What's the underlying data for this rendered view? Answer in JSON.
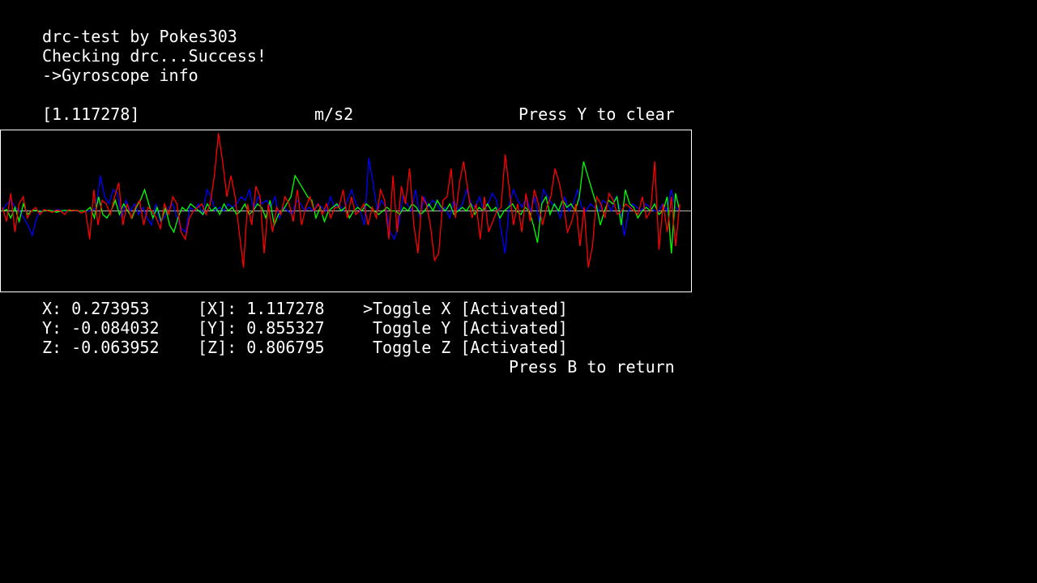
{
  "header": {
    "title": "drc-test by Pokes303",
    "status": "Checking drc...Success!",
    "menu_item": "->Gyroscope info"
  },
  "graph_header": {
    "scale_value": "[1.117278]",
    "unit": "m/s2",
    "clear_hint": "Press Y to clear"
  },
  "readings": {
    "x": "X: 0.273953",
    "y": "Y: -0.084032",
    "z": "Z: -0.063952",
    "max_x": "[X]: 1.117278",
    "max_y": "[Y]: 0.855327",
    "max_z": "[Z]: 0.806795"
  },
  "toggles": {
    "x": ">Toggle X [Activated]",
    "y": "Toggle Y [Activated]",
    "z": "Toggle Z [Activated]"
  },
  "footer": {
    "return_hint": "Press B to return"
  },
  "colors": {
    "background": "#000000",
    "text": "#ffffff",
    "x_series": "#ff0000",
    "y_series": "#00ff00",
    "z_series": "#0000ff",
    "center_line": "#ffffff"
  },
  "chart_data": {
    "type": "line",
    "title": "",
    "ylabel": "m/s2",
    "ylim": [
      -1.117278,
      1.117278
    ],
    "series": [
      {
        "name": "X",
        "color": "#ff0000",
        "values": [
          0.05,
          -0.15,
          0.25,
          -0.3,
          0.1,
          0.2,
          -0.1,
          0.0,
          0.05,
          -0.05,
          0.02,
          0.0,
          -0.02,
          0.01,
          0.0,
          -0.05,
          0.02,
          0.0,
          0.01,
          -0.03,
          0.0,
          -0.4,
          0.3,
          -0.2,
          0.15,
          0.1,
          -0.05,
          0.2,
          0.4,
          -0.2,
          0.1,
          -0.1,
          0.05,
          0.15,
          -0.2,
          0.05,
          0.0,
          -0.1,
          -0.25,
          0.1,
          -0.05,
          0.2,
          0.1,
          -0.3,
          -0.4,
          -0.1,
          0.0,
          0.05,
          0.1,
          -0.05,
          0.1,
          0.5,
          1.1,
          0.7,
          0.2,
          0.5,
          0.2,
          -0.3,
          -0.8,
          0.1,
          -0.2,
          0.35,
          0.2,
          -0.6,
          0.1,
          -0.3,
          0.05,
          -0.05,
          0.2,
          0.1,
          -0.15,
          0.3,
          -0.2,
          0.05,
          0.2,
          0.0,
          0.1,
          -0.05,
          0.1,
          -0.1,
          0.05,
          0.05,
          0.3,
          -0.1,
          0.2,
          -0.05,
          0.0,
          0.1,
          -0.2,
          0.05,
          -0.1,
          0.3,
          0.15,
          -0.4,
          0.5,
          -0.3,
          0.35,
          0.1,
          0.6,
          -0.2,
          -0.6,
          0.2,
          0.1,
          -0.2,
          -0.7,
          -0.6,
          0.15,
          0.2,
          0.6,
          -0.1,
          0.4,
          0.7,
          0.3,
          -0.1,
          0.1,
          -0.4,
          0.2,
          -0.3,
          -0.15,
          0.0,
          0.05,
          0.8,
          0.3,
          -0.2,
          0.1,
          -0.3,
          0.25,
          -0.15,
          0.3,
          0.1,
          -0.2,
          0.05,
          0.2,
          0.6,
          0.4,
          0.1,
          -0.3,
          -0.15,
          0.1,
          -0.5,
          0.05,
          -0.8,
          -0.5,
          0.2,
          0.1,
          -0.1,
          0.25,
          0.15,
          -0.05,
          0.0,
          0.1,
          0.05,
          0.0,
          -0.05,
          0.2,
          -0.1,
          0.0,
          0.7,
          -0.55,
          0.1,
          -0.3,
          0.2,
          -0.5,
          0.1
        ]
      },
      {
        "name": "Y",
        "color": "#00ff00",
        "values": [
          0.0,
          0.02,
          -0.1,
          0.05,
          -0.15,
          0.1,
          -0.05,
          0.0,
          0.01,
          -0.01,
          0.0,
          0.01,
          0.0,
          -0.02,
          0.0,
          0.01,
          0.0,
          0.01,
          0.0,
          0.0,
          0.0,
          0.05,
          -0.1,
          0.2,
          -0.05,
          -0.1,
          0.0,
          0.15,
          -0.05,
          0.1,
          0.0,
          -0.1,
          0.05,
          0.15,
          0.3,
          0.1,
          -0.1,
          0.05,
          -0.15,
          0.05,
          -0.2,
          -0.3,
          -0.1,
          0.05,
          0.0,
          0.1,
          0.05,
          0.0,
          -0.05,
          0.1,
          0.0,
          0.05,
          -0.05,
          0.1,
          0.0,
          0.05,
          -0.05,
          0.0,
          0.1,
          -0.05,
          0.0,
          0.1,
          0.05,
          -0.1,
          0.15,
          -0.2,
          -0.05,
          0.0,
          0.1,
          0.2,
          0.5,
          0.4,
          0.3,
          0.2,
          0.15,
          -0.1,
          0.05,
          -0.15,
          0.0,
          0.05,
          0.1,
          0.0,
          0.05,
          -0.1,
          0.0,
          0.05,
          0.0,
          0.1,
          0.05,
          0.0,
          -0.05,
          0.0,
          0.05,
          0.0,
          0.0,
          -0.05,
          0.05,
          0.0,
          0.1,
          0.05,
          -0.05,
          0.0,
          0.1,
          0.0,
          0.15,
          0.05,
          0.0,
          0.1,
          -0.05,
          0.0,
          0.05,
          0.0,
          0.1,
          -0.05,
          0.05,
          0.0,
          0.1,
          0.0,
          0.05,
          -0.1,
          0.0,
          0.05,
          0.1,
          0.0,
          -0.05,
          0.05,
          0.0,
          -0.2,
          -0.45,
          0.1,
          0.2,
          -0.05,
          0.1,
          0.0,
          0.15,
          0.05,
          0.1,
          0.0,
          0.2,
          0.7,
          0.5,
          0.3,
          0.1,
          -0.2,
          0.0,
          0.15,
          0.1,
          0.2,
          -0.2,
          0.3,
          0.1,
          0.05,
          -0.1,
          0.0,
          0.05,
          0.0,
          0.1,
          -0.05,
          0.0,
          0.2,
          -0.6,
          0.25,
          0.0
        ]
      },
      {
        "name": "Z",
        "color": "#0000ff",
        "values": [
          0.0,
          0.1,
          0.15,
          0.05,
          0.0,
          -0.1,
          -0.2,
          -0.35,
          -0.1,
          0.0,
          0.01,
          0.0,
          0.0,
          0.02,
          0.0,
          0.0,
          0.01,
          0.0,
          0.0,
          0.0,
          0.0,
          0.0,
          0.05,
          0.5,
          0.2,
          0.1,
          0.3,
          0.25,
          -0.1,
          0.15,
          0.0,
          0.1,
          -0.05,
          0.05,
          -0.1,
          -0.2,
          0.1,
          -0.15,
          -0.1,
          0.05,
          0.1,
          -0.1,
          -0.25,
          -0.3,
          0.05,
          0.0,
          0.1,
          -0.05,
          0.3,
          0.2,
          0.0,
          0.05,
          0.0,
          0.1,
          0.05,
          0.1,
          0.2,
          0.15,
          0.3,
          0.0,
          0.2,
          0.1,
          0.15,
          0.05,
          0.2,
          -0.1,
          0.05,
          0.0,
          -0.05,
          0.15,
          0.1,
          0.0,
          0.05,
          0.0,
          0.1,
          0.05,
          0.0,
          0.2,
          0.05,
          0.1,
          0.0,
          0.15,
          0.3,
          0.1,
          0.0,
          -0.2,
          0.75,
          0.4,
          0.0,
          0.15,
          0.05,
          -0.3,
          -0.4,
          -0.2,
          0.2,
          0.1,
          0.0,
          0.3,
          -0.1,
          0.2,
          0.05,
          0.15,
          0.1,
          0.0,
          0.05,
          -0.1,
          0.15,
          0.0,
          0.1,
          0.3,
          0.1,
          0.05,
          0.2,
          0.0,
          0.1,
          0.25,
          0.15,
          -0.25,
          -0.6,
          0.1,
          0.3,
          0.15,
          0.05,
          0.2,
          0.0,
          0.2,
          -0.15,
          0.3,
          0.2,
          0.1,
          0.05,
          -0.1,
          0.2,
          0.0,
          0.1,
          0.3,
          0.05,
          0.0,
          0.1,
          0.05,
          0.0,
          0.15,
          0.1,
          0.0,
          0.2,
          0.05,
          -0.35,
          0.0,
          0.1,
          0.05,
          0.0,
          0.1,
          0.05,
          0.0,
          0.0,
          0.1,
          0.0,
          0.3,
          0.05,
          0.0
        ]
      }
    ]
  }
}
